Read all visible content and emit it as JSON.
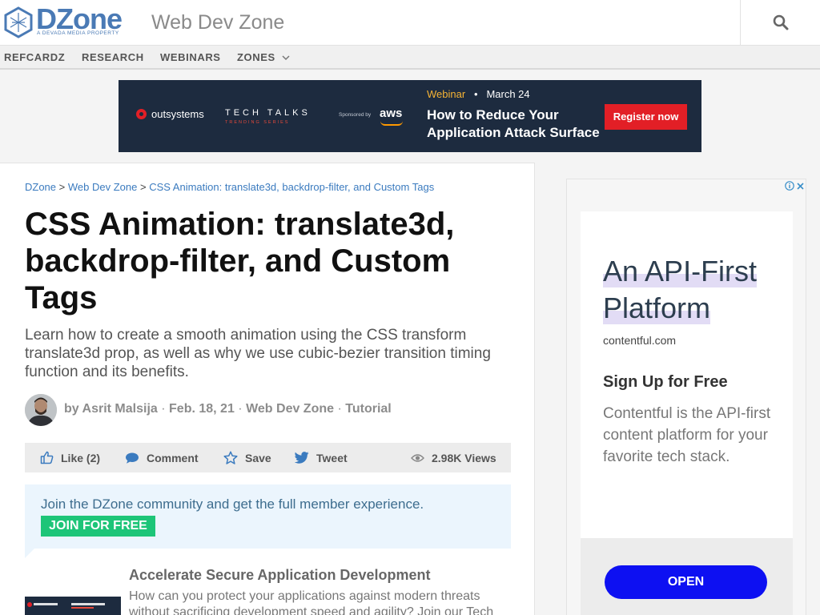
{
  "header": {
    "logo_text": "DZone",
    "logo_tagline": "A DEVADA MEDIA PROPERTY",
    "zone_title": "Web Dev Zone",
    "search_icon": "search-icon"
  },
  "nav": {
    "items": [
      {
        "label": "REFCARDZ"
      },
      {
        "label": "RESEARCH"
      },
      {
        "label": "WEBINARS"
      },
      {
        "label": "ZONES"
      }
    ],
    "zones_icon": "chevron-down-icon"
  },
  "banner": {
    "brand": "outsystems",
    "tech_talks": "TECH TALKS",
    "trending": "TRENDING SERIES",
    "sponsored": "Sponsored by",
    "sponsor": "aws",
    "webinar_label": "Webinar",
    "date": "March 24",
    "headline": "How to Reduce Your Application Attack Surface",
    "cta": "Register now"
  },
  "breadcrumb": {
    "items": [
      "DZone",
      "Web Dev Zone",
      "CSS Animation: translate3d, backdrop-filter, and Custom Tags"
    ],
    "separator": ">"
  },
  "article": {
    "title": "CSS Animation: translate3d, backdrop-filter, and Custom Tags",
    "description": "Learn how to create a smooth animation using the CSS transform translate3d prop, as well as why we use cubic-bezier transition timing function and its benefits.",
    "author": "by Asrit Malsija",
    "date": "Feb. 18, 21",
    "zone": "Web Dev Zone",
    "type": "Tutorial",
    "dot": "·"
  },
  "actions": {
    "like": "Like (2)",
    "comment": "Comment",
    "save": "Save",
    "tweet": "Tweet",
    "views": "2.98K Views"
  },
  "join": {
    "text": "Join the DZone community and get the full member experience.",
    "button": "JOIN FOR FREE"
  },
  "related": {
    "title": "Accelerate Secure Application Development",
    "text": "How can you protect your applications against modern threats without sacrificing development speed and agility? Join our Tech"
  },
  "ad": {
    "headline_1": "An API-First",
    "headline_2": "Platform",
    "domain": "contentful.com",
    "subhead": "Sign Up for Free",
    "body": "Contentful is the API-first content platform for your favorite tech stack.",
    "cta": "OPEN"
  },
  "colors": {
    "brand_blue": "#4a7ab5",
    "link_blue": "#3b7bbf",
    "join_green": "#1dc578",
    "register_red": "#e21f26",
    "open_blue": "#0d10f2"
  }
}
